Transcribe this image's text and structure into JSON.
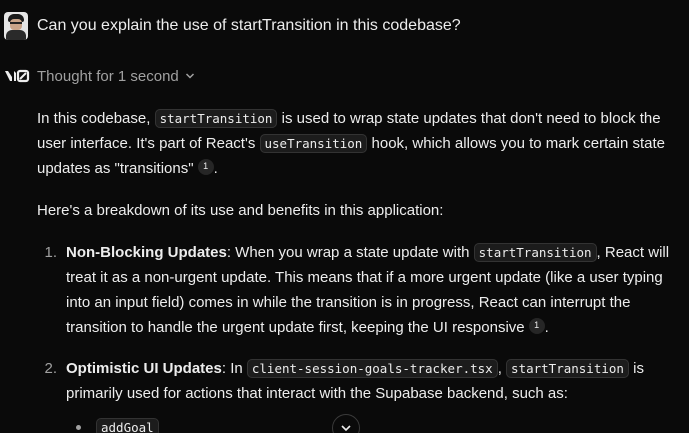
{
  "user_message": {
    "text": "Can you explain the use of startTransition in this codebase?"
  },
  "thought": {
    "label": "Thought for 1 second"
  },
  "answer": {
    "p1": {
      "t1": "In this codebase, ",
      "code1": "startTransition",
      "t2": " is used to wrap state updates that don't need to block the user interface. It's part of React's ",
      "code2": "useTransition",
      "t3": " hook, which allows you to mark certain state updates as \"transitions\"",
      "cite": "1",
      "t4": "."
    },
    "p2": "Here's a breakdown of its use and benefits in this application:",
    "items": [
      {
        "number": "1.",
        "title": "Non-Blocking Updates",
        "t1": ": When you wrap a state update with ",
        "code1": "startTransition",
        "t2": ", React will treat it as a non-urgent update. This means that if a more urgent update (like a user typing into an input field) comes in while the transition is in progress, React can interrupt the transition to handle the urgent update first, keeping the UI responsive",
        "cite": "1",
        "t3": "."
      },
      {
        "number": "2.",
        "title": "Optimistic UI Updates",
        "t1": ": In ",
        "code1": "client-session-goals-tracker.tsx",
        "t2": ", ",
        "code2": "startTransition",
        "t3": " is primarily used for actions that interact with the Supabase backend, such as:"
      }
    ],
    "sub_items": [
      "addGoal"
    ]
  }
}
